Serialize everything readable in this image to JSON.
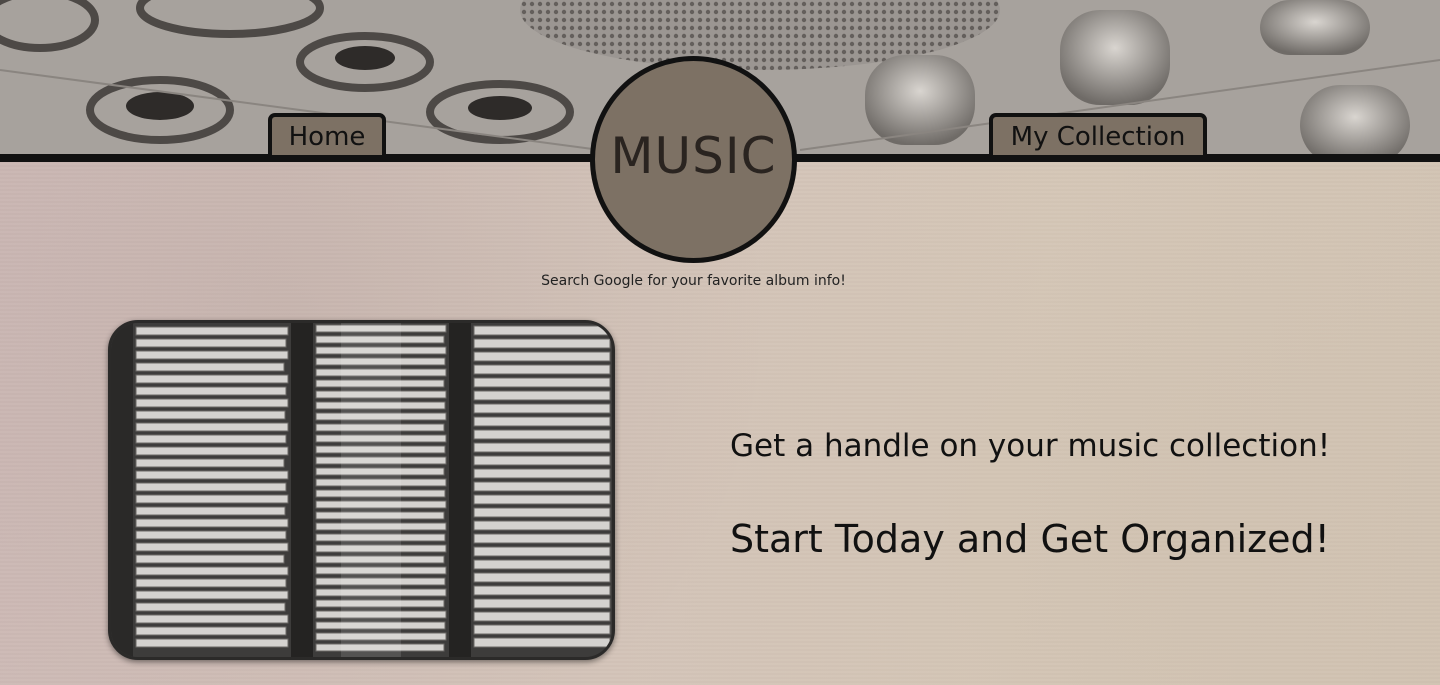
{
  "nav": {
    "home_label": "Home",
    "collection_label": "My Collection"
  },
  "logo": {
    "text": "MUSIC"
  },
  "search_hint": "Search Google for your favorite album info!",
  "taglines": {
    "line1": "Get a handle on your music collection!",
    "line2": "Start Today and Get Organized!"
  },
  "colors": {
    "tab_fill": "#7d7164",
    "border": "#111111",
    "page_background": "#d3c3b9"
  }
}
